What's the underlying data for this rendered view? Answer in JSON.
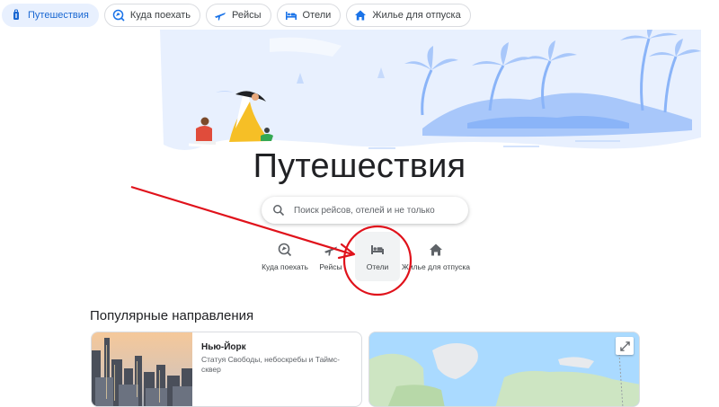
{
  "nav": {
    "items": [
      {
        "label": "Путешествия",
        "icon": "travel-bag-icon",
        "active": true
      },
      {
        "label": "Куда поехать",
        "icon": "explore-icon",
        "active": false
      },
      {
        "label": "Рейсы",
        "icon": "plane-icon",
        "active": false
      },
      {
        "label": "Отели",
        "icon": "bed-icon",
        "active": false
      },
      {
        "label": "Жилье для отпуска",
        "icon": "house-icon",
        "active": false
      }
    ]
  },
  "hero": {
    "title": "Путешествия"
  },
  "search": {
    "placeholder": "Поиск рейсов, отелей и не только"
  },
  "quick_actions": [
    {
      "label": "Куда поехать",
      "icon": "explore-icon"
    },
    {
      "label": "Рейсы",
      "icon": "plane-icon"
    },
    {
      "label": "Отели",
      "icon": "bed-icon",
      "highlighted": true
    },
    {
      "label": "Жилье для отпуска",
      "icon": "house-icon"
    }
  ],
  "popular": {
    "title": "Популярные направления",
    "cards": [
      {
        "name": "Нью-Йорк",
        "description": "Статуя Свободы, небоскребы и Таймс-сквер"
      }
    ]
  },
  "colors": {
    "accent": "#1a73e8",
    "active_chip_bg": "#e8f0fe",
    "annotation": "#e0121b",
    "illustration_blue": "#a8c7fa"
  }
}
